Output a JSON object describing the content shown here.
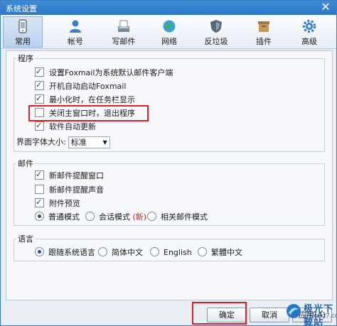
{
  "window": {
    "title": "系统设置",
    "close_glyph": "✕"
  },
  "toolbar": [
    {
      "label": "常用",
      "icon": "phone-icon",
      "active": true
    },
    {
      "label": "帐号",
      "icon": "user-icon"
    },
    {
      "label": "写邮件",
      "icon": "compose-icon"
    },
    {
      "label": "网络",
      "icon": "globe-icon"
    },
    {
      "label": "反垃圾",
      "icon": "shield-icon"
    },
    {
      "label": "插件",
      "icon": "plugin-box-icon"
    },
    {
      "label": "高级",
      "icon": "gear-icon"
    }
  ],
  "program": {
    "legend": "程序",
    "items": [
      {
        "label": "设置Foxmail为系统默认邮件客户端",
        "checked": true
      },
      {
        "label": "开机自动启动Foxmail",
        "checked": true
      },
      {
        "label": "最小化时，在任务栏显示",
        "checked": true
      },
      {
        "label": "关闭主窗口时，退出程序",
        "checked": false
      },
      {
        "label": "软件自动更新",
        "checked": true
      }
    ],
    "font_size_label": "界面字体大小:",
    "font_size_value": "标准"
  },
  "mail": {
    "legend": "邮件",
    "items": [
      {
        "label": "新邮件提醒窗口",
        "checked": true
      },
      {
        "label": "新邮件提醒声音",
        "checked": false
      },
      {
        "label": "附件预览",
        "checked": true
      }
    ],
    "modes": [
      {
        "label": "普通模式",
        "selected": true
      },
      {
        "label": "会话模式",
        "selected": false,
        "tag": "(新)"
      },
      {
        "label": "相关邮件模式",
        "selected": false
      }
    ]
  },
  "language": {
    "legend": "语言",
    "options": [
      {
        "label": "跟随系统语言",
        "selected": true
      },
      {
        "label": "简体中文",
        "selected": false
      },
      {
        "label": "English",
        "selected": false
      },
      {
        "label": "繁體中文",
        "selected": false
      }
    ]
  },
  "buttons": {
    "ok": "确定",
    "cancel": "取消",
    "apply": "应用(A)"
  },
  "watermark": {
    "title": "极光下载站",
    "url": "www.xz7.com"
  },
  "colors": {
    "titlebar": "#2f78c5",
    "highlight": "#e02020",
    "accent": "#1f5fa8"
  }
}
